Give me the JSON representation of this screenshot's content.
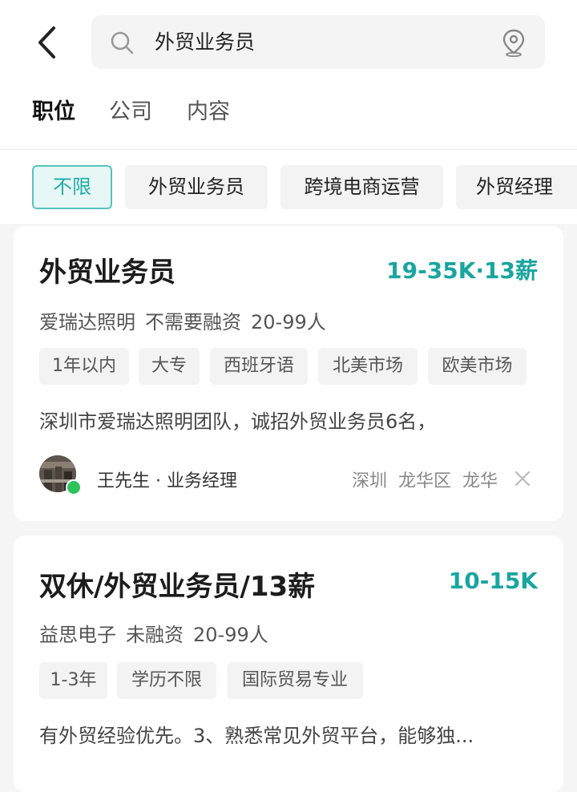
{
  "search": {
    "query": "外贸业务员"
  },
  "tabs": [
    {
      "label": "职位",
      "active": true
    },
    {
      "label": "公司",
      "active": false
    },
    {
      "label": "内容",
      "active": false
    }
  ],
  "filters": [
    {
      "label": "不限",
      "active": true
    },
    {
      "label": "外贸业务员",
      "active": false
    },
    {
      "label": "跨境电商运营",
      "active": false
    },
    {
      "label": "外贸经理",
      "active": false
    }
  ],
  "jobs": [
    {
      "title": "外贸业务员",
      "salary": "19-35K·13薪",
      "company": "爱瑞达照明",
      "funding": "不需要融资",
      "size": "20-99人",
      "tags": [
        "1年以内",
        "大专",
        "西班牙语",
        "北美市场",
        "欧美市场"
      ],
      "description": "深圳市爱瑞达照明团队，诚招外贸业务员6名，",
      "recruiter": "王先生 · 业务经理",
      "location": [
        "深圳",
        "龙华区",
        "龙华"
      ]
    },
    {
      "title": "双休/外贸业务员/13薪",
      "salary": "10-15K",
      "company": "益思电子",
      "funding": "未融资",
      "size": "20-99人",
      "tags": [
        "1-3年",
        "学历不限",
        "国际贸易专业"
      ],
      "description": "有外贸经验优先。3、熟悉常见外贸平台，能够独..."
    }
  ],
  "colors": {
    "accent": "#1aa59f",
    "online": "#2dc35a",
    "chip_active_bg": "#e6f7f6"
  },
  "icons": {
    "back": "chevron-left-icon",
    "search": "search-icon",
    "location": "location-pin-icon",
    "close": "close-icon"
  }
}
